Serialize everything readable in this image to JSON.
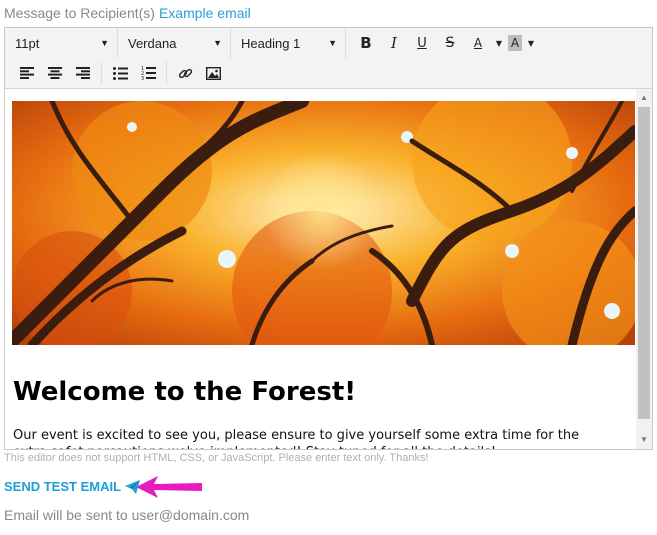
{
  "header": {
    "label": "Message to Recipient(s)",
    "example_link": "Example email"
  },
  "toolbar": {
    "font_size": "11pt",
    "font_family": "Verdana",
    "block_format": "Heading 1",
    "bold": "B",
    "italic": "I",
    "underline": "U",
    "strikethrough": "S",
    "text_color": "A",
    "bg_color": "A"
  },
  "content": {
    "heading": "Welcome to the Forest!",
    "paragraph": "Our event is excited to see you, please ensure to give yourself some extra time for the extra safet porcautions we've implemented! Stay tuned for all the details!"
  },
  "editor_note": "This editor does not support HTML, CSS, or JavaScript. Please enter text only. Thanks!",
  "send_button": {
    "label": "SEND TEST EMAIL"
  },
  "email_notice": "Email will be sent to user@domain.com",
  "colors": {
    "accent": "#2a9fd6",
    "arrow": "#e61cc0"
  }
}
